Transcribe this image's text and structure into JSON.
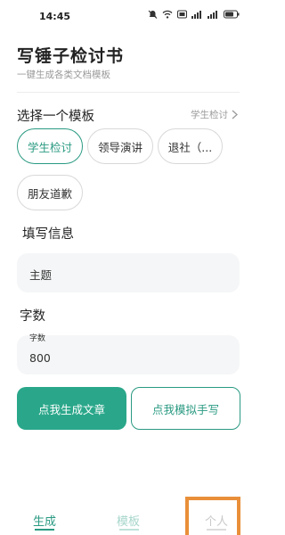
{
  "status": {
    "time": "14:45"
  },
  "header": {
    "title": "写锤子检讨书",
    "subtitle": "一键生成各类文档模板"
  },
  "templates": {
    "section_label": "选择一个模板",
    "current": "学生检讨",
    "chips": [
      "学生检讨",
      "领导演讲",
      "退社（...",
      "朋友道歉"
    ]
  },
  "form": {
    "info_label": "填写信息",
    "topic_placeholder": "主题",
    "count_label": "字数",
    "count_field_label": "字数",
    "count_value": "800"
  },
  "actions": {
    "generate": "点我生成文章",
    "handwrite": "点我模拟手写"
  },
  "tabbar": {
    "generate": "生成",
    "template": "模板",
    "profile": "个人"
  },
  "colors": {
    "accent": "#2aa78a",
    "highlight": "#e98f3a"
  }
}
